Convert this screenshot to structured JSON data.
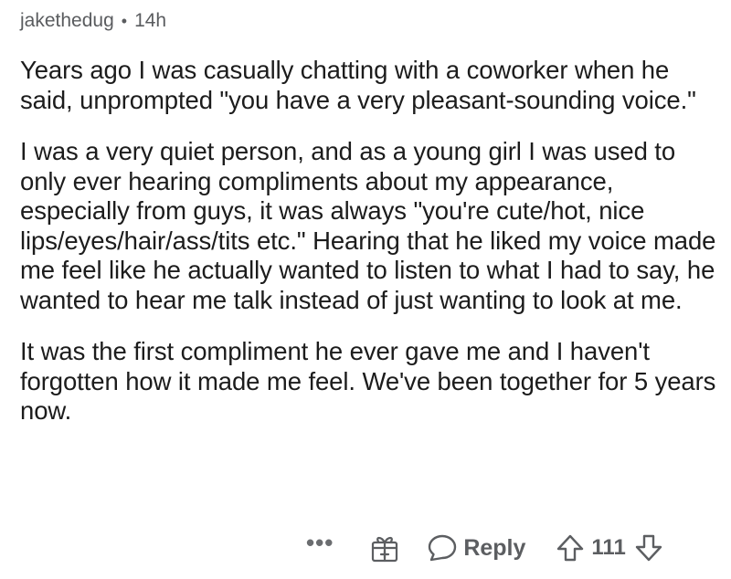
{
  "comment": {
    "username": "jakethedug",
    "separator": "•",
    "time": "14h",
    "paragraphs": [
      "Years ago I was casually chatting with a coworker when he said, unprompted \"you have a very pleasant-sounding voice.\"",
      "I was a very quiet person, and as a young girl I was used to only ever hearing compliments about my appearance, especially from guys, it was always \"you're cute/hot, nice lips/eyes/hair/ass/tits etc.\" Hearing that he liked my voice made me feel like he actually wanted to listen to what I had to say, he wanted to hear me talk instead of just wanting to look at me.",
      "It was the first compliment he ever gave me and I haven't forgotten how it made me feel. We've been together for 5 years now."
    ]
  },
  "actions": {
    "more": "•••",
    "award_icon": "gift-icon",
    "reply_icon": "speech-bubble-icon",
    "reply_label": "Reply",
    "upvote_icon": "upvote-arrow-icon",
    "score": "111",
    "downvote_icon": "downvote-arrow-icon"
  }
}
